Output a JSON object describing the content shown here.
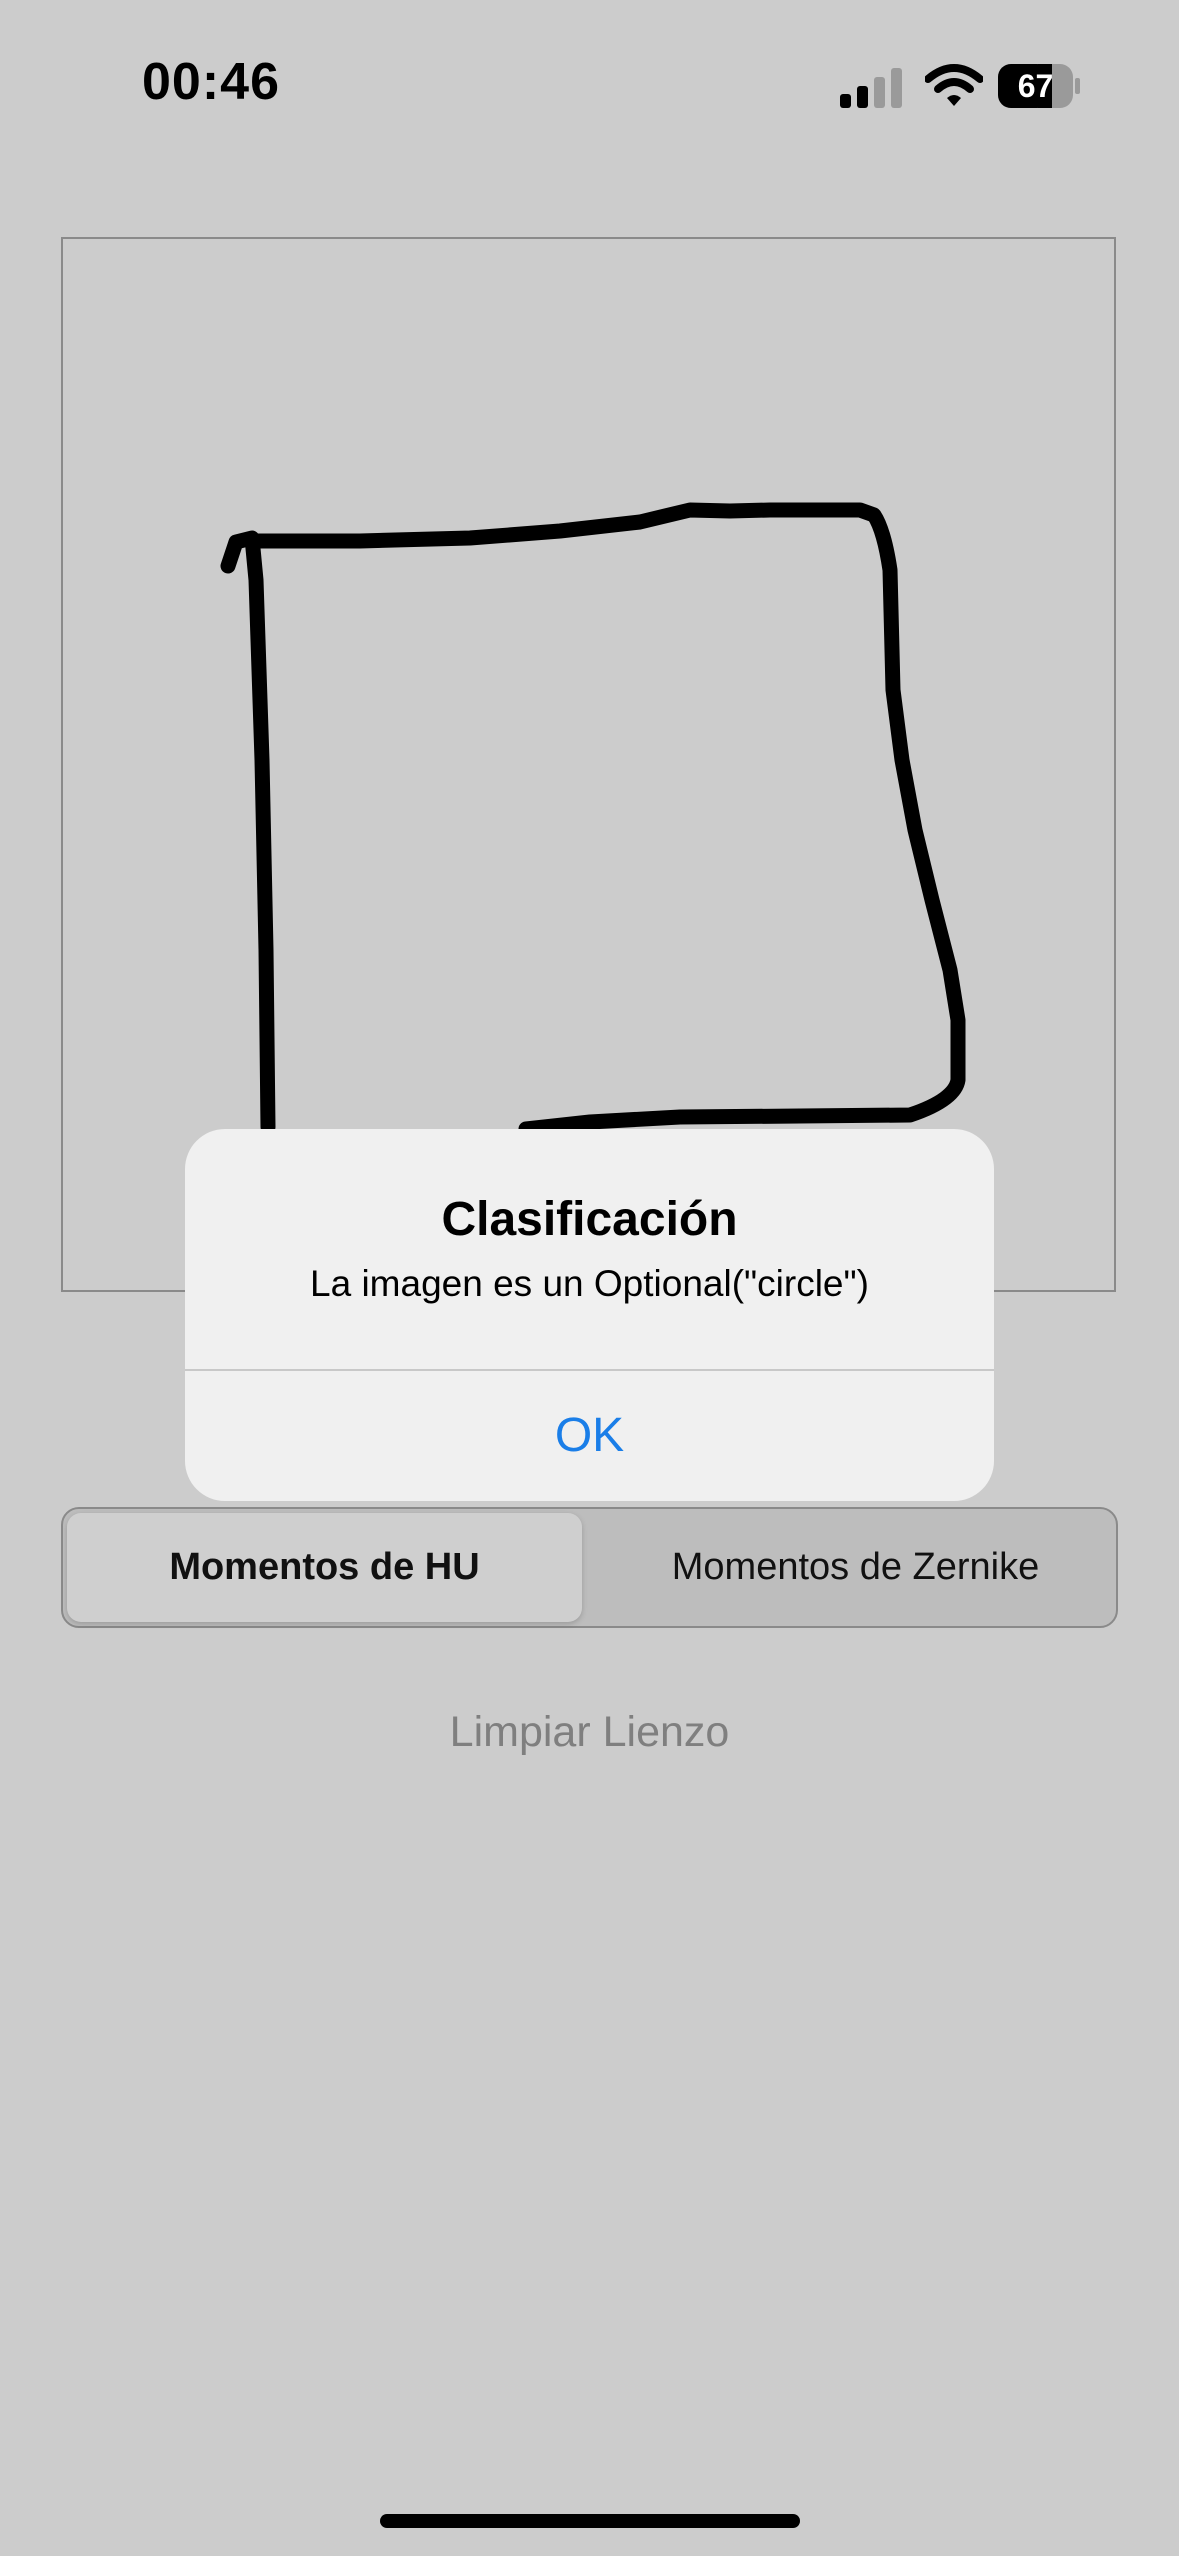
{
  "status_bar": {
    "time": "00:46",
    "battery_level": "67",
    "icons": [
      "signal-icon",
      "wifi-icon",
      "battery-icon"
    ]
  },
  "canvas": {
    "stroke_color": "#000000"
  },
  "segmented_control": {
    "options": [
      "Momentos de HU",
      "Momentos de Zernike"
    ],
    "selected": "Momentos de HU"
  },
  "clear_button": {
    "label": "Limpiar Lienzo"
  },
  "alert": {
    "title": "Clasificación",
    "message": "La imagen es un Optional(\"circle\")",
    "ok_label": "OK",
    "ok_color": "#1a7ee8"
  }
}
